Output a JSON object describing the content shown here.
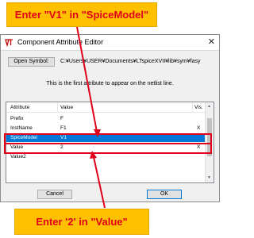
{
  "annotations": {
    "callout_top": "Enter \"V1\" in \"SpiceModel\"",
    "callout_bottom": "Enter '2' in \"Value\"",
    "annotation_color": "#e0001b",
    "callout_fill": "#ffc000"
  },
  "dialog": {
    "title": "Component Attribute Editor",
    "close_glyph": "✕",
    "open_symbol_label": "Open Symbol:",
    "symbol_path": "C:¥Users¥USER¥Documents¥LTspiceXVII¥lib¥sym¥fasy",
    "info_text": "This is the first attribute to appear on the netlist line.",
    "table": {
      "headers": [
        "Attribute",
        "Value",
        "Vis."
      ],
      "rows": [
        {
          "attribute": "Prefix",
          "value": "F",
          "vis": ""
        },
        {
          "attribute": "InstName",
          "value": "F1",
          "vis": "X"
        },
        {
          "attribute": "SpiceModel",
          "value": "V1",
          "vis": "",
          "selected": true
        },
        {
          "attribute": "Value",
          "value": "2",
          "vis": "X"
        },
        {
          "attribute": "Value2",
          "value": "",
          "vis": ""
        }
      ]
    },
    "cancel_label": "Cancel",
    "ok_label": "OK",
    "selection_color": "#0078d7"
  }
}
